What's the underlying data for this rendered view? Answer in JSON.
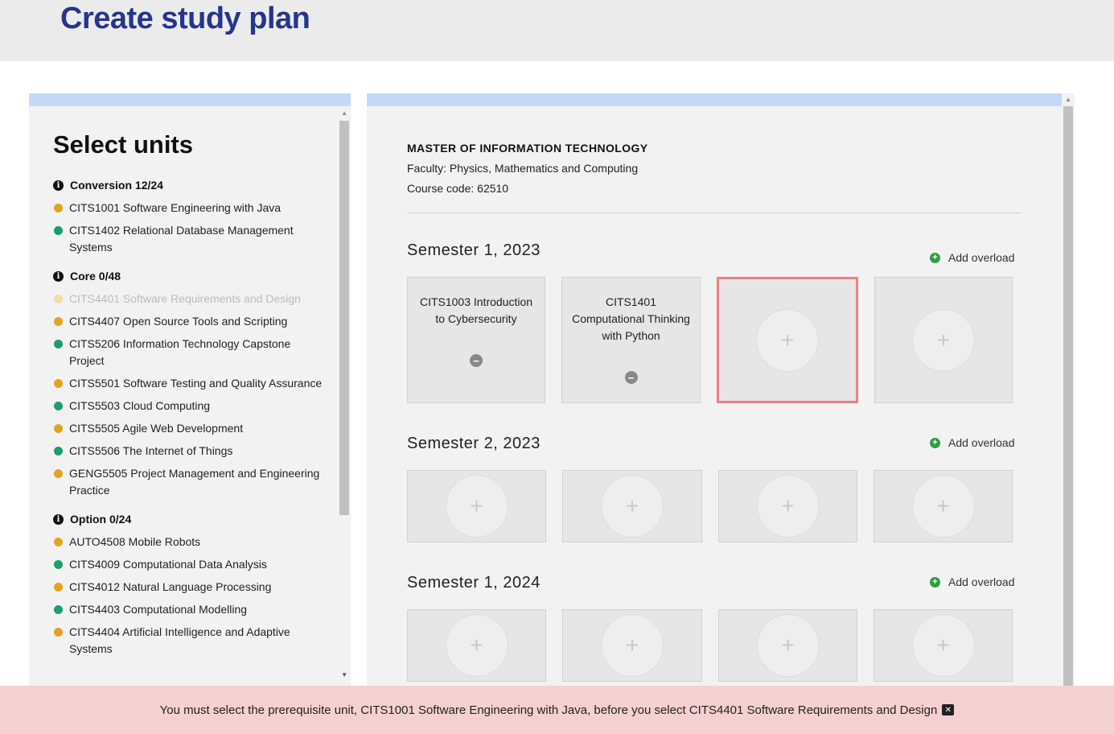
{
  "header": {
    "title": "Create study plan"
  },
  "sidebar": {
    "title": "Select units",
    "groups": [
      {
        "label": "Conversion 12/24",
        "units": [
          {
            "label": "CITS1001 Software Engineering with Java",
            "color": "#e5a21b"
          },
          {
            "label": "CITS1402 Relational Database Management Systems",
            "color": "#1a9e6e"
          }
        ]
      },
      {
        "label": "Core 0/48",
        "units": [
          {
            "label": "CITS4401 Software Requirements and Design",
            "color": "#f1dca6"
          },
          {
            "label": "CITS4407 Open Source Tools and Scripting",
            "color": "#e5a21b"
          },
          {
            "label": "CITS5206 Information Technology Capstone Project",
            "color": "#1a9e6e"
          },
          {
            "label": "CITS5501 Software Testing and Quality Assurance",
            "color": "#e5a21b"
          },
          {
            "label": "CITS5503 Cloud Computing",
            "color": "#1a9e6e"
          },
          {
            "label": "CITS5505 Agile Web Development",
            "color": "#e5a21b"
          },
          {
            "label": "CITS5506 The Internet of Things",
            "color": "#1a9e6e"
          },
          {
            "label": "GENG5505 Project Management and Engineering Practice",
            "color": "#e5a21b"
          }
        ]
      },
      {
        "label": "Option 0/24",
        "units": [
          {
            "label": "AUTO4508 Mobile Robots",
            "color": "#e5a21b"
          },
          {
            "label": "CITS4009 Computational Data Analysis",
            "color": "#1a9e6e"
          },
          {
            "label": "CITS4012 Natural Language Processing",
            "color": "#e5a21b"
          },
          {
            "label": "CITS4403 Computational Modelling",
            "color": "#1a9e6e"
          },
          {
            "label": "CITS4404 Artificial Intelligence and Adaptive Systems",
            "color": "#e5a21b"
          }
        ]
      }
    ]
  },
  "course": {
    "title": "MASTER OF INFORMATION TECHNOLOGY",
    "faculty": "Faculty: Physics, Mathematics and Computing",
    "code": "Course code: 62510"
  },
  "semesters": [
    {
      "title": "Semester 1, 2023",
      "overload_label": "Add overload",
      "slots": [
        {
          "unit": "CITS1003 Introduction to Cybersecurity"
        },
        {
          "unit": "CITS1401 Computational Thinking with Python"
        },
        {
          "unit": "",
          "selected": true
        },
        {
          "unit": ""
        }
      ]
    },
    {
      "title": "Semester 2, 2023",
      "overload_label": "Add overload",
      "slots": [
        {
          "unit": ""
        },
        {
          "unit": ""
        },
        {
          "unit": ""
        },
        {
          "unit": ""
        }
      ]
    },
    {
      "title": "Semester 1, 2024",
      "overload_label": "Add overload",
      "slots": [
        {
          "unit": ""
        },
        {
          "unit": ""
        },
        {
          "unit": ""
        },
        {
          "unit": ""
        }
      ]
    }
  ],
  "icons": {
    "add": "plus-icon",
    "remove": "minus-icon",
    "info": "info-icon",
    "close": "close-icon"
  },
  "alert": {
    "message": "You must select the prerequisite unit, CITS1001 Software Engineering with Java, before you select CITS4401 Software Requirements and Design"
  }
}
